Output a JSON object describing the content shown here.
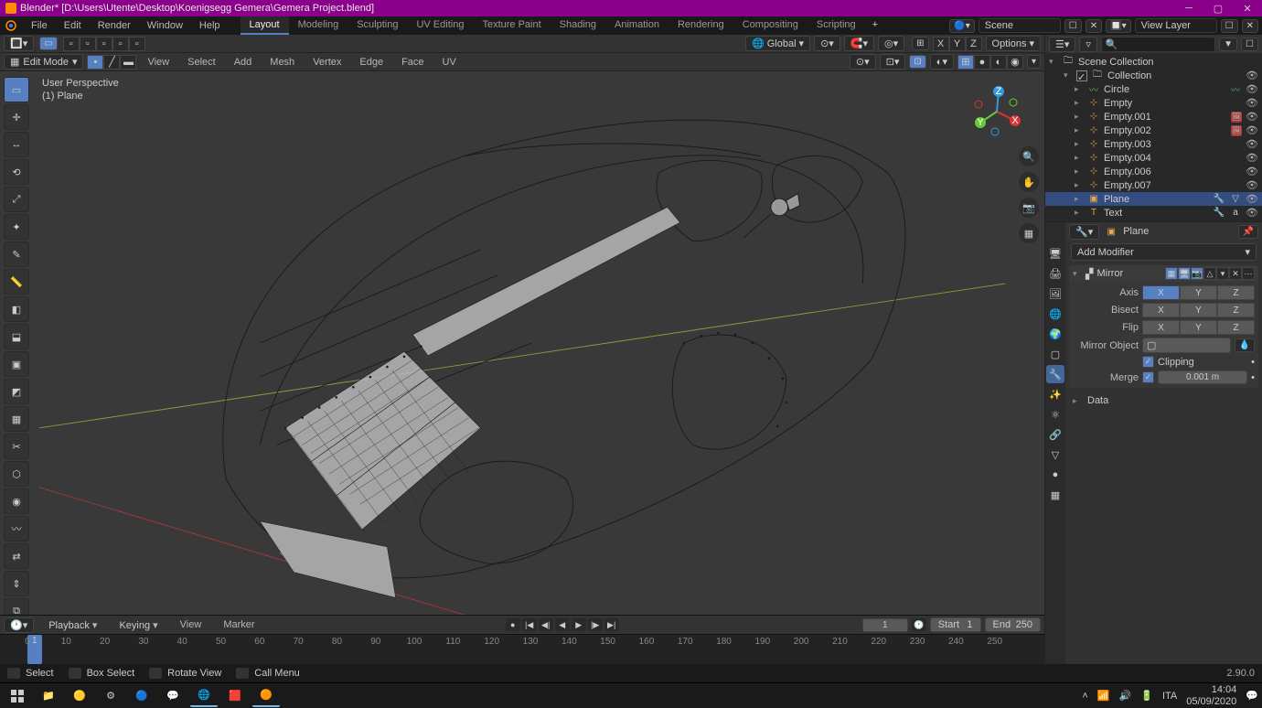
{
  "titlebar": {
    "title": "Blender* [D:\\Users\\Utente\\Desktop\\Koenigsegg Gemera\\Gemera Project.blend]"
  },
  "topmenu": {
    "items": [
      "File",
      "Edit",
      "Render",
      "Window",
      "Help"
    ],
    "workspaces": [
      "Layout",
      "Modeling",
      "Sculpting",
      "UV Editing",
      "Texture Paint",
      "Shading",
      "Animation",
      "Rendering",
      "Compositing",
      "Scripting"
    ],
    "active_workspace": "Layout",
    "scene_label": "Scene",
    "viewlayer_label": "View Layer"
  },
  "viewport_header": {
    "orientation": "Global",
    "options_label": "Options"
  },
  "viewport_subheader": {
    "mode": "Edit Mode",
    "menus": [
      "View",
      "Select",
      "Add",
      "Mesh",
      "Vertex",
      "Edge",
      "Face",
      "UV"
    ]
  },
  "viewport_overlay": {
    "perspective": "User Perspective",
    "object": "(1) Plane"
  },
  "outliner": {
    "root": "Scene Collection",
    "collection": "Collection",
    "items": [
      {
        "name": "Circle",
        "type": "curve",
        "selected": false
      },
      {
        "name": "Empty",
        "type": "empty",
        "selected": false
      },
      {
        "name": "Empty.001",
        "type": "empty",
        "badge": true,
        "selected": false
      },
      {
        "name": "Empty.002",
        "type": "empty",
        "badge": true,
        "selected": false
      },
      {
        "name": "Empty.003",
        "type": "empty",
        "selected": false
      },
      {
        "name": "Empty.004",
        "type": "empty",
        "selected": false
      },
      {
        "name": "Empty.006",
        "type": "empty",
        "selected": false
      },
      {
        "name": "Empty.007",
        "type": "empty",
        "selected": false
      },
      {
        "name": "Plane",
        "type": "mesh",
        "selected": true
      },
      {
        "name": "Text",
        "type": "text",
        "selected": false
      }
    ]
  },
  "properties": {
    "context_name": "Plane",
    "add_modifier": "Add Modifier",
    "mirror": {
      "name": "Mirror",
      "axis_label": "Axis",
      "bisect_label": "Bisect",
      "flip_label": "Flip",
      "axes": [
        "X",
        "Y",
        "Z"
      ],
      "axis_on": [
        true,
        false,
        false
      ],
      "bisect_on": [
        false,
        false,
        false
      ],
      "flip_on": [
        false,
        false,
        false
      ],
      "mirror_object_label": "Mirror Object",
      "mirror_object_value": "",
      "clipping_label": "Clipping",
      "clipping_on": true,
      "merge_label": "Merge",
      "merge_on": true,
      "merge_value": "0.001 m"
    },
    "data_label": "Data"
  },
  "timeline": {
    "menus": [
      "Playback",
      "Keying",
      "View",
      "Marker"
    ],
    "current": "1",
    "start_label": "Start",
    "start_value": "1",
    "end_label": "End",
    "end_value": "250",
    "ticks": [
      0,
      10,
      20,
      30,
      40,
      50,
      60,
      70,
      80,
      90,
      100,
      110,
      120,
      130,
      140,
      150,
      160,
      170,
      180,
      190,
      200,
      210,
      220,
      230,
      240,
      250
    ]
  },
  "statusbar": {
    "select": "Select",
    "box_select": "Box Select",
    "rotate_view": "Rotate View",
    "call_menu": "Call Menu",
    "version": "2.90.0"
  },
  "taskbar": {
    "lang": "ITA",
    "time": "14:04",
    "date": "05/09/2020"
  }
}
